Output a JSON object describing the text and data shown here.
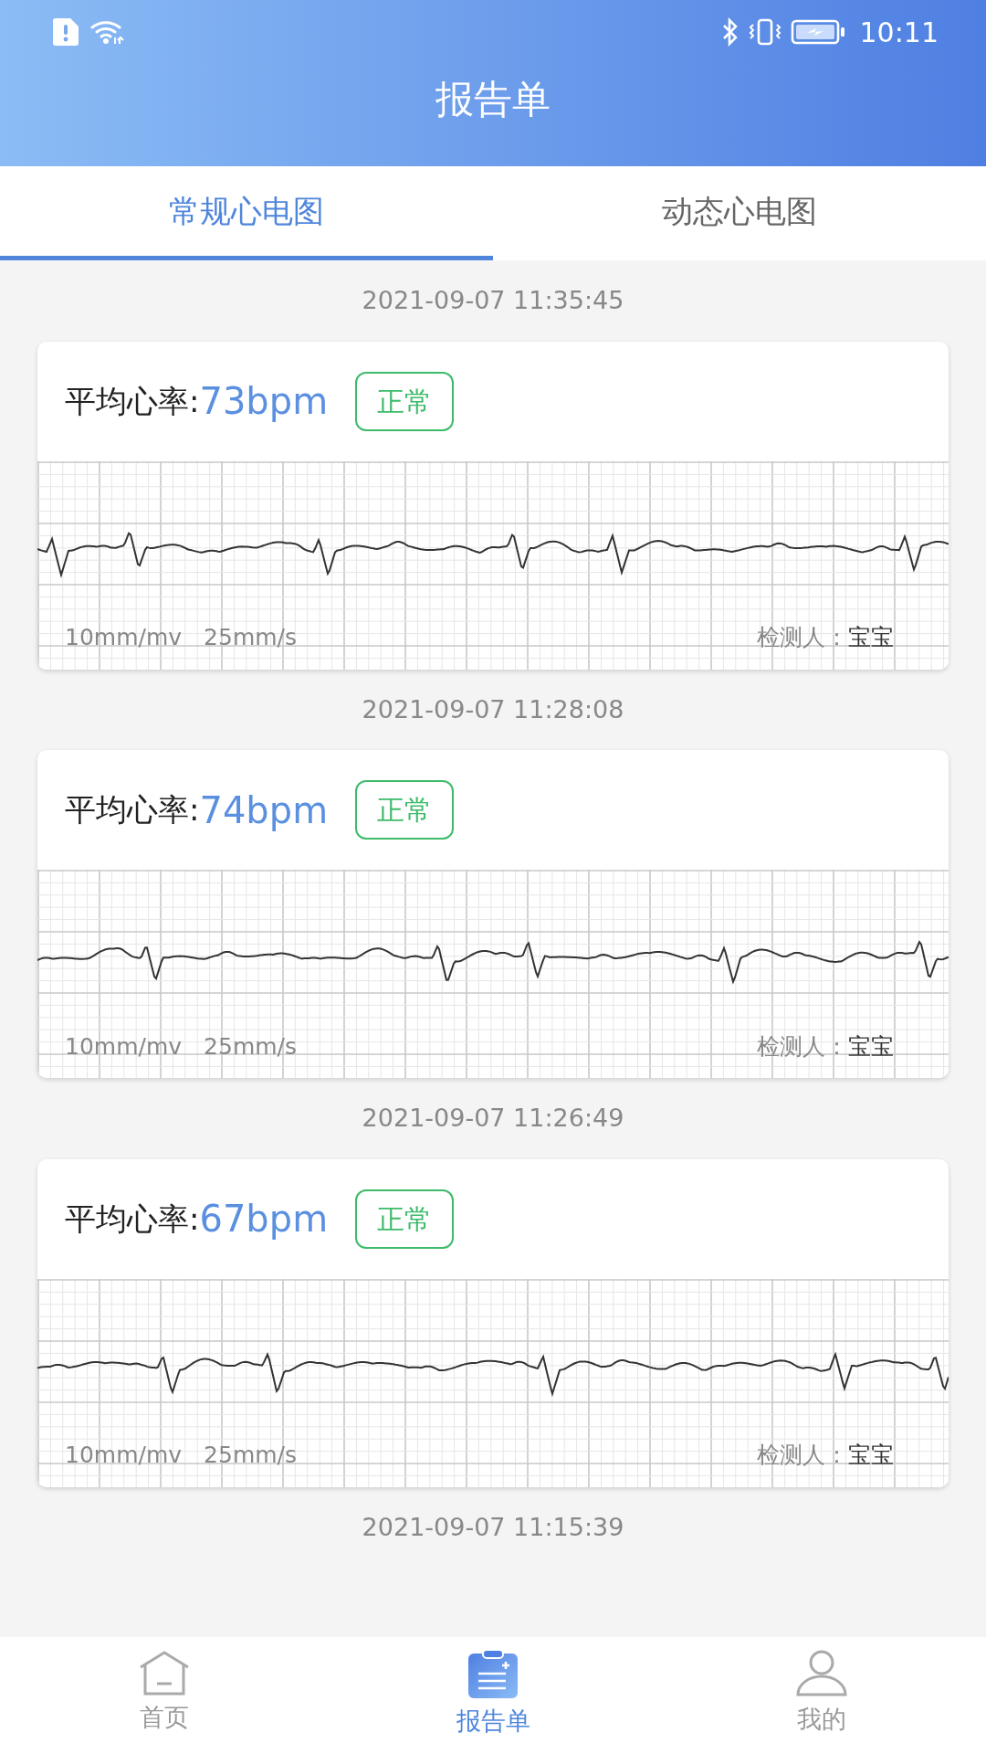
{
  "status_bar": {
    "time": "10:11"
  },
  "header": {
    "title": "报告单"
  },
  "tabs": [
    {
      "label": "常规心电图",
      "selected": true
    },
    {
      "label": "动态心电图",
      "selected": false
    }
  ],
  "records": [
    {
      "time": "2021-09-07 11:35:45",
      "card": {
        "rate_label": "平均心率:",
        "rate": "73bpm",
        "status": "正常",
        "gain": "10mm/mv",
        "speed": "25mm/s",
        "tester_label": "检测人：",
        "tester": "宝宝"
      }
    },
    {
      "time": "2021-09-07 11:28:08",
      "card": {
        "rate_label": "平均心率:",
        "rate": "74bpm",
        "status": "正常",
        "gain": "10mm/mv",
        "speed": "25mm/s",
        "tester_label": "检测人：",
        "tester": "宝宝"
      }
    },
    {
      "time": "2021-09-07 11:26:49",
      "card": {
        "rate_label": "平均心率:",
        "rate": "67bpm",
        "status": "正常",
        "gain": "10mm/mv",
        "speed": "25mm/s",
        "tester_label": "检测人：",
        "tester": "宝宝"
      }
    },
    {
      "time": "2021-09-07 11:15:39"
    }
  ],
  "bottom_nav": [
    {
      "kind": "home",
      "label": "首页",
      "selected": false
    },
    {
      "kind": "report",
      "label": "报告单",
      "selected": true
    },
    {
      "kind": "profile",
      "label": "我的",
      "selected": false
    }
  ]
}
